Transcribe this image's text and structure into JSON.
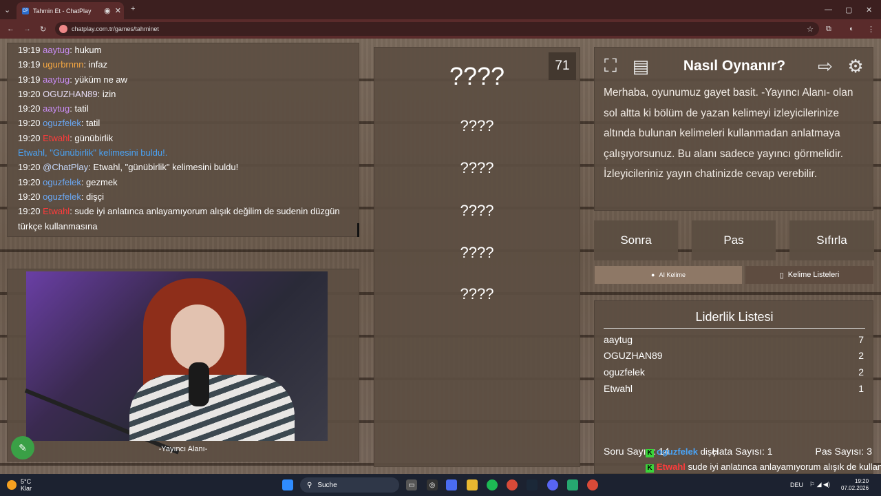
{
  "browser": {
    "tab_title": "Tahmin Et - ChatPlay",
    "url": "chatplay.com.tr/games/tahminet"
  },
  "chat": {
    "lines": [
      {
        "time": "19:19",
        "user": "aaytug",
        "color": "#c98df5",
        "msg": ": hukum"
      },
      {
        "time": "19:19",
        "user": "ugurbrnnn",
        "color": "#f5a742",
        "msg": ": infaz"
      },
      {
        "time": "19:19",
        "user": "aaytug",
        "color": "#c98df5",
        "msg": ": yüküm ne aw"
      },
      {
        "time": "19:20",
        "user": "OGUZHAN89",
        "color": "#e6dcf5",
        "msg": ": izin"
      },
      {
        "time": "19:20",
        "user": "aaytug",
        "color": "#c98df5",
        "msg": ": tatil"
      },
      {
        "time": "19:20",
        "user": "oguzfelek",
        "color": "#6aa8f5",
        "msg": ": tatil"
      },
      {
        "time": "19:20",
        "user": "Etwahl",
        "color": "#ff3b3b",
        "msg": ": günübirlik"
      },
      {
        "time": "",
        "user": "Etwahl, \"Günübirlik\" kelimesini buldu!.",
        "color": "#4aa3f5",
        "msg": ""
      },
      {
        "time": "19:20",
        "user": "@ChatPlay",
        "color": "#c8dcff",
        "msg": ": Etwahl, \"günübirlik\" kelimesini buldu!"
      },
      {
        "time": "19:20",
        "user": "oguzfelek",
        "color": "#6aa8f5",
        "msg": ": gezmek"
      },
      {
        "time": "19:20",
        "user": "oguzfelek",
        "color": "#6aa8f5",
        "msg": ": dişçi"
      },
      {
        "time": "19:20",
        "user": "Etwahl",
        "color": "#ff3b3b",
        "msg": ": sude iyi anlatınca anlayamıyorum alışık değilim de sudenin düzgün türkçe kullanmasına"
      }
    ]
  },
  "video": {
    "label": "-Yayıncı Alanı-"
  },
  "words": {
    "counter": "71",
    "items": [
      "????",
      "????",
      "????",
      "????",
      "????",
      "????"
    ]
  },
  "help": {
    "title": "Nasıl Oynanır?",
    "text": "Merhaba, oyunumuz gayet basit. -Yayıncı Alanı- olan sol altta ki bölüm de yazan kelimeyi izleyicilerinize altında bulunan kelimeleri kullanmadan anlatmaya çalışıyorsunuz. Bu alanı sadece yayıncı görmelidir. İzleyicileriniz yayın chatinizde cevap verebilir."
  },
  "buttons": {
    "next": "Sonra",
    "pass": "Pas",
    "reset": "Sıfırla"
  },
  "tabs": {
    "ai": "AI Kelime",
    "lists": "Kelime Listeleri"
  },
  "leaderboard": {
    "title": "Liderlik Listesi",
    "rows": [
      {
        "name": "aaytug",
        "score": "7"
      },
      {
        "name": "OGUZHAN89",
        "score": "2"
      },
      {
        "name": "oguzfelek",
        "score": "2"
      },
      {
        "name": "Etwahl",
        "score": "1"
      }
    ]
  },
  "stats": {
    "question": "Soru Sayısı: 14",
    "errors": "Hata Sayısı: 1",
    "passes": "Pas Sayısı: 3"
  },
  "overlay": {
    "line1_user": "oguzfelek",
    "line1_msg": "dişçi",
    "line2_user": "Etwahl",
    "line2_msg": "sude iyi anlatınca anlayamıyorum alışık de kullanmasına"
  },
  "taskbar": {
    "weather_temp": "5°C",
    "weather_desc": "Klar",
    "search": "Suche",
    "lang": "DEU",
    "time": "19:20",
    "date": "07.02.2026"
  },
  "colors": {
    "accent_green": "#3aa046",
    "tab_bg": "#5a2b2b"
  }
}
